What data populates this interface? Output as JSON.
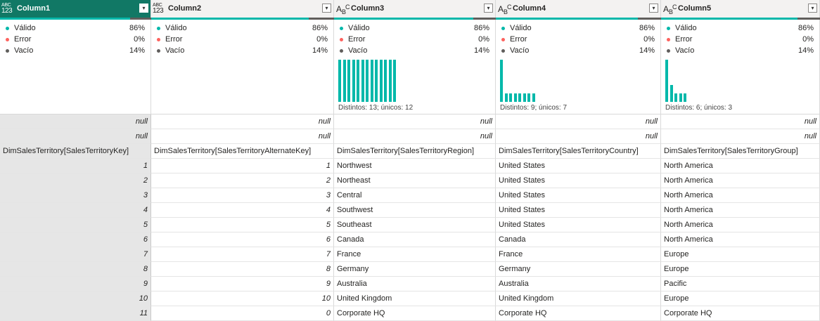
{
  "colors": {
    "selected_header": "#117865",
    "valid": "#01b8aa",
    "error": "#fd625e",
    "empty": "#605e5c"
  },
  "columns": [
    {
      "name": "Column1",
      "type_icon": "ABC123",
      "valid_label": "Válido",
      "valid": "86%",
      "error_label": "Error",
      "error": "0%",
      "empty_label": "Vacío",
      "empty": "14%",
      "distinct": "",
      "hist": []
    },
    {
      "name": "Column2",
      "type_icon": "ABC123",
      "valid_label": "Válido",
      "valid": "86%",
      "error_label": "Error",
      "error": "0%",
      "empty_label": "Vacío",
      "empty": "14%",
      "distinct": "",
      "hist": []
    },
    {
      "name": "Column3",
      "type_icon": "ABC",
      "valid_label": "Válido",
      "valid": "86%",
      "error_label": "Error",
      "error": "0%",
      "empty_label": "Vacío",
      "empty": "14%",
      "distinct": "Distintos: 13; únicos: 12",
      "hist": [
        1,
        1,
        1,
        1,
        1,
        1,
        1,
        1,
        1,
        1,
        1,
        1,
        1
      ]
    },
    {
      "name": "Column4",
      "type_icon": "ABC",
      "valid_label": "Válido",
      "valid": "86%",
      "error_label": "Error",
      "error": "0%",
      "empty_label": "Vacío",
      "empty": "14%",
      "distinct": "Distintos: 9; únicos: 7",
      "hist": [
        5,
        1,
        1,
        1,
        1,
        1,
        1,
        1
      ]
    },
    {
      "name": "Column5",
      "type_icon": "ABC",
      "valid_label": "Válido",
      "valid": "86%",
      "error_label": "Error",
      "error": "0%",
      "empty_label": "Vacío",
      "empty": "14%",
      "distinct": "Distintos: 6; únicos: 3",
      "hist": [
        5,
        2,
        1,
        1,
        1
      ]
    }
  ],
  "rows": [
    [
      "null",
      "null",
      "null",
      "null",
      "null"
    ],
    [
      "null",
      "null",
      "null",
      "null",
      "null"
    ],
    [
      "DimSalesTerritory[SalesTerritoryKey]",
      "DimSalesTerritory[SalesTerritoryAlternateKey]",
      "DimSalesTerritory[SalesTerritoryRegion]",
      "DimSalesTerritory[SalesTerritoryCountry]",
      "DimSalesTerritory[SalesTerritoryGroup]"
    ],
    [
      "1",
      "1",
      "Northwest",
      "United States",
      "North America"
    ],
    [
      "2",
      "2",
      "Northeast",
      "United States",
      "North America"
    ],
    [
      "3",
      "3",
      "Central",
      "United States",
      "North America"
    ],
    [
      "4",
      "4",
      "Southwest",
      "United States",
      "North America"
    ],
    [
      "5",
      "5",
      "Southeast",
      "United States",
      "North America"
    ],
    [
      "6",
      "6",
      "Canada",
      "Canada",
      "North America"
    ],
    [
      "7",
      "7",
      "France",
      "France",
      "Europe"
    ],
    [
      "8",
      "8",
      "Germany",
      "Germany",
      "Europe"
    ],
    [
      "9",
      "9",
      "Australia",
      "Australia",
      "Pacific"
    ],
    [
      "10",
      "10",
      "United Kingdom",
      "United Kingdom",
      "Europe"
    ],
    [
      "11",
      "0",
      "Corporate HQ",
      "Corporate HQ",
      "Corporate HQ"
    ]
  ]
}
